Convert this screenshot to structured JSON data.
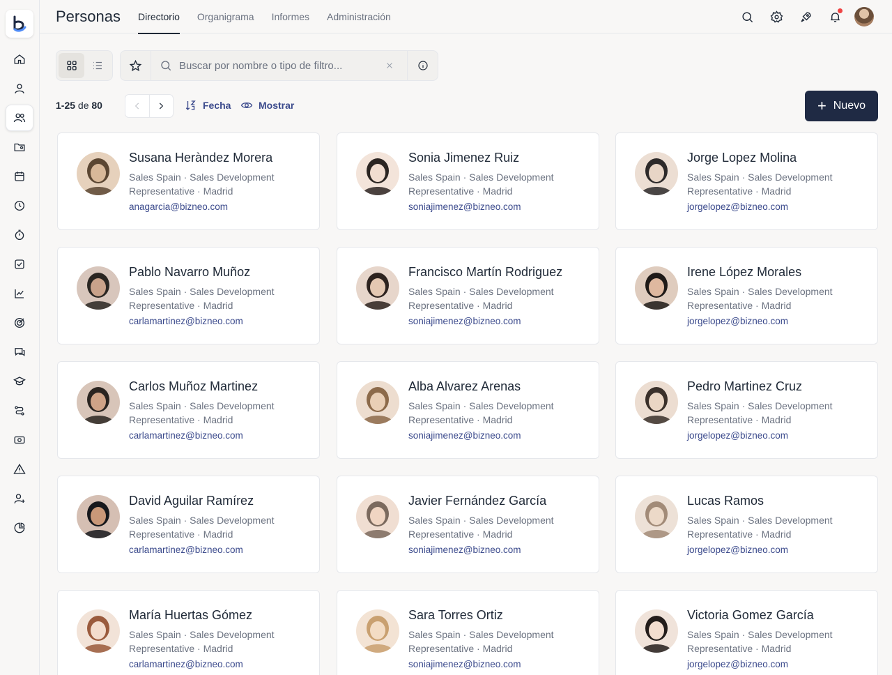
{
  "app": {
    "title": "Personas"
  },
  "tabs": [
    {
      "label": "Directorio",
      "active": true
    },
    {
      "label": "Organigrama"
    },
    {
      "label": "Informes"
    },
    {
      "label": "Administración"
    }
  ],
  "search": {
    "placeholder": "Buscar por nombre o tipo de filtro..."
  },
  "pagination": {
    "range": "1-25",
    "of": "de",
    "total": "80"
  },
  "sort": {
    "label": "Fecha"
  },
  "show": {
    "label": "Mostrar"
  },
  "new_button": {
    "label": "Nuevo"
  },
  "colors": {
    "accent": "#3b4a8c",
    "primary": "#1f2a44",
    "notification": "#ef4444"
  },
  "people": [
    {
      "name": "Susana Heràndez Morera",
      "role": "Sales Spain · Sales Development Representative · Madrid",
      "email": "anagarcia@bizneo.com"
    },
    {
      "name": "Sonia Jimenez Ruiz",
      "role": "Sales Spain · Sales Development Representative · Madrid",
      "email": "soniajimenez@bizneo.com"
    },
    {
      "name": "Jorge Lopez Molina",
      "role": "Sales Spain · Sales Development Representative · Madrid",
      "email": "jorgelopez@bizneo.com"
    },
    {
      "name": "Pablo Navarro Muñoz",
      "role": "Sales Spain · Sales Development Representative · Madrid",
      "email": "carlamartinez@bizneo.com"
    },
    {
      "name": "Francisco Martín Rodriguez",
      "role": "Sales Spain · Sales Development Representative · Madrid",
      "email": "soniajimenez@bizneo.com"
    },
    {
      "name": "Irene López Morales",
      "role": "Sales Spain · Sales Development Representative · Madrid",
      "email": "jorgelopez@bizneo.com"
    },
    {
      "name": "Carlos Muñoz Martinez",
      "role": "Sales Spain · Sales Development Representative · Madrid",
      "email": "carlamartinez@bizneo.com"
    },
    {
      "name": "Alba  Alvarez Arenas",
      "role": "Sales Spain · Sales Development Representative · Madrid",
      "email": "soniajimenez@bizneo.com"
    },
    {
      "name": "Pedro Martinez Cruz",
      "role": "Sales Spain · Sales Development Representative · Madrid",
      "email": "jorgelopez@bizneo.com"
    },
    {
      "name": "David Aguilar Ramírez",
      "role": "Sales Spain · Sales Development Representative · Madrid",
      "email": "carlamartinez@bizneo.com"
    },
    {
      "name": "Javier Fernández García",
      "role": "Sales Spain · Sales Development Representative · Madrid",
      "email": "soniajimenez@bizneo.com"
    },
    {
      "name": "Lucas Ramos",
      "role": "Sales Spain · Sales Development Representative · Madrid",
      "email": "jorgelopez@bizneo.com"
    },
    {
      "name": "María Huertas Gómez",
      "role": "Sales Spain · Sales Development Representative · Madrid",
      "email": "carlamartinez@bizneo.com"
    },
    {
      "name": "Sara Torres Ortiz",
      "role": "Sales Spain · Sales Development Representative · Madrid",
      "email": "soniajimenez@bizneo.com"
    },
    {
      "name": "Victoria Gomez García",
      "role": "Sales Spain · Sales Development Representative · Madrid",
      "email": "jorgelopez@bizneo.com"
    }
  ]
}
